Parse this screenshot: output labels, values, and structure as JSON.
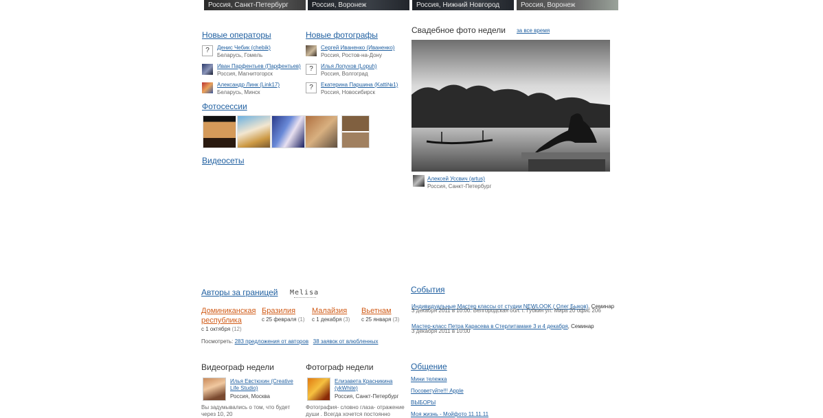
{
  "strip": [
    {
      "label": "Россия, Санкт-Петербург"
    },
    {
      "label": "Россия, Воронеж"
    },
    {
      "label": "Россия, Нижний Новгород"
    },
    {
      "label": "Россия, Воронеж"
    }
  ],
  "new_operators": {
    "title": "Новые операторы",
    "items": [
      {
        "name": "Денис Чебик (chebik)",
        "location": "Беларусь, Гомель",
        "avatar": "?"
      },
      {
        "name": "Иван Парфентьев (Парфентьев)",
        "location": "Россия, Магнитогорск",
        "avatar": ""
      },
      {
        "name": "Александр Линк (Link17)",
        "location": "Беларусь, Минск",
        "avatar": ""
      }
    ]
  },
  "new_photographers": {
    "title": "Новые фотографы",
    "items": [
      {
        "name": "Сергей Иваненко (Иваненко)",
        "location": "Россия, Ростов-на-Дону",
        "avatar": ""
      },
      {
        "name": "Илья Лопухов (Lopuh)",
        "location": "Россия, Волгоград",
        "avatar": "?"
      },
      {
        "name": "Екатерина Паршина (Katti№1)",
        "location": "Россия, Новосибирск",
        "avatar": "?"
      }
    ]
  },
  "photosessions": {
    "title": "Фотосессии"
  },
  "videosets": {
    "title": "Видеосеты"
  },
  "wedding_photo": {
    "title": "Свадебное фото недели",
    "all_time": "за все время",
    "author_name": "Алексей Уссвич (artus)",
    "author_location": "Россия, Санкт-Петербург"
  },
  "abroad": {
    "title": "Авторы за границей",
    "logo": "Melisa",
    "countries": [
      {
        "name": "Доминиканская республика",
        "date": "с 1 октября",
        "count": "(12)"
      },
      {
        "name": "Бразилия",
        "date": "с 25 февраля",
        "count": "(1)"
      },
      {
        "name": "Малайзия",
        "date": "с 1 декабря",
        "count": "(3)"
      },
      {
        "name": "Вьетнам",
        "date": "с 25 января",
        "count": "(3)"
      }
    ],
    "view_label": "Посмотреть:",
    "link_offers": "283 предложения от авторов",
    "link_requests": "38 заявок от влюбленных"
  },
  "events": {
    "title": "События",
    "items": [
      {
        "link": "Индивидуальные Мастер классы от студии NEWLOOK ( Олег Быков)",
        "tail": ", Семинар",
        "date": "3 декабря 2011 в 10:00. Белгородская обл. г. Губкин ул. Мира 20 офис 206"
      },
      {
        "link": "Мастер-класс Петра Карасева в Стерлитамаке 3 и 4 декабря",
        "tail": ", Семинар",
        "date": "3 декабря 2011 в 10:00"
      }
    ]
  },
  "videographer": {
    "title": "Видеограф недели",
    "name": "Илья Евстюхин (Creative Life Studio)",
    "location": "Россия, Москва",
    "quote": "Вы задумывались о том, что будет через 10, 20"
  },
  "photographer": {
    "title": "Фотограф недели",
    "name": "Елизавета Красникина (ykWhite)",
    "location": "Россия, Санкт-Петербург",
    "quote": "Фотография- словно глаза- отражение души . Всегда хочется постоянно"
  },
  "communication": {
    "title": "Общение",
    "items": [
      "Мини тележка",
      "Посоветуйте!!! Apple",
      "ВЫБОРЫ",
      "Моя жизнь - Мойфото 11.11.11"
    ]
  }
}
